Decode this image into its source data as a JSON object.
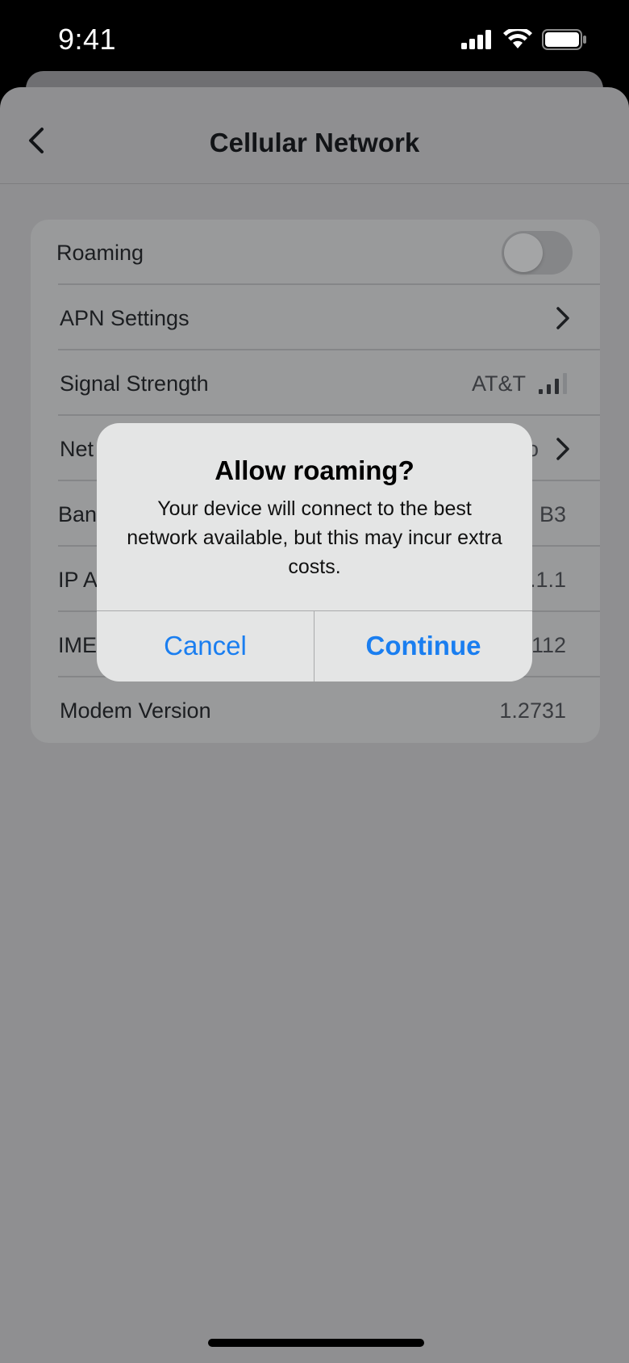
{
  "status_bar": {
    "time": "9:41"
  },
  "nav": {
    "title": "Cellular Network"
  },
  "settings": {
    "roaming_label": "Roaming",
    "roaming_enabled": false,
    "apn_label": "APN Settings",
    "signal_label": "Signal Strength",
    "signal_carrier": "AT&T",
    "network_label": "Net",
    "network_value": "o",
    "band_label": "Ban",
    "band_value": "B3",
    "ip_label": "IP A",
    "ip_value": ".1.1",
    "imei_label": "IME",
    "imei_value": "112",
    "modem_label": "Modem Version",
    "modem_value": "1.2731"
  },
  "alert": {
    "title": "Allow roaming?",
    "message": "Your device will connect to the best network available, but this may incur extra costs.",
    "cancel_label": "Cancel",
    "continue_label": "Continue"
  },
  "colors": {
    "accent": "#1a7ef0",
    "dim_background": "#8f8f91",
    "alert_background": "#e4e5e5"
  }
}
